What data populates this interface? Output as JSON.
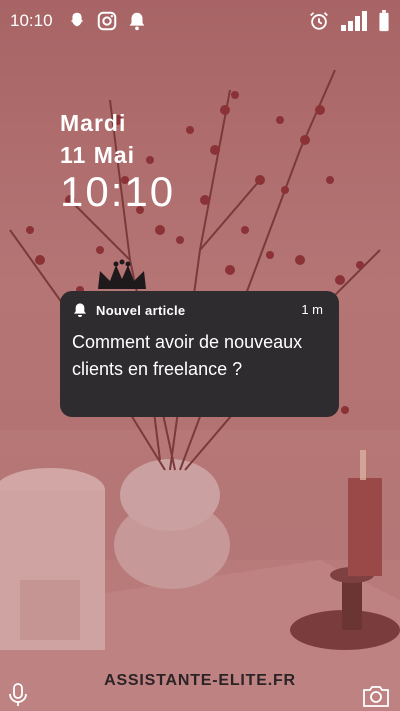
{
  "status_bar": {
    "time": "10:10",
    "left_icons": [
      "snapchat-icon",
      "instagram-icon",
      "bell-icon"
    ],
    "right_icons": [
      "alarm-icon",
      "signal-icon",
      "battery-icon"
    ]
  },
  "lock_screen": {
    "day": "Mardi",
    "date": "11 Mai",
    "time": "10:10"
  },
  "notification": {
    "app_name": "Nouvel article",
    "age": "1 m",
    "message": "Comment avoir de nouveaux clients en freelance ?",
    "icon": "bell-icon"
  },
  "footer": {
    "brand": "ASSISTANTE-ELITE.FR",
    "left_icon": "microphone-icon",
    "right_icon": "camera-icon"
  },
  "colors": {
    "background": "#b27272",
    "card": "#2e2c2e",
    "text": "#ffffff",
    "brand_text": "#2b2325"
  }
}
